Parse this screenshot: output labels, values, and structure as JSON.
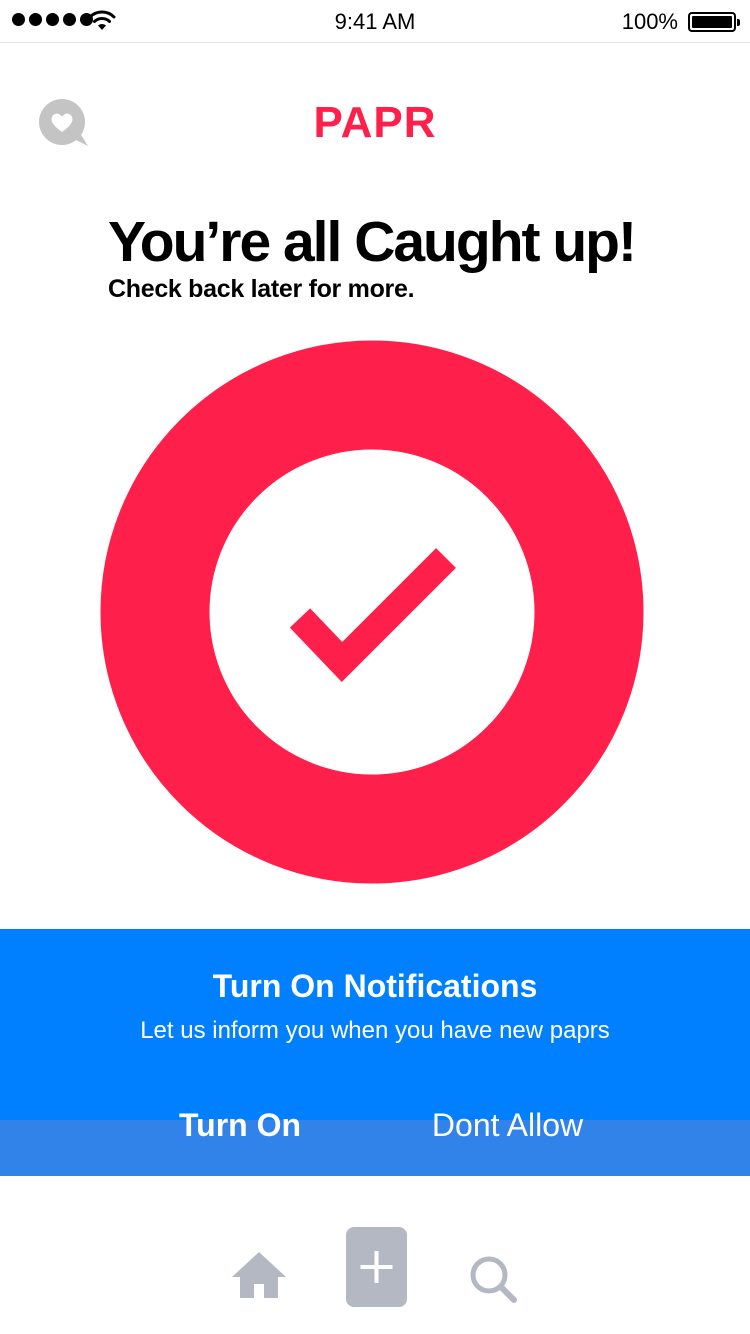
{
  "status_bar": {
    "time": "9:41 AM",
    "battery": "100%"
  },
  "header": {
    "brand": "PAPR",
    "chat_icon": "heart-chat-icon"
  },
  "main": {
    "headline": "You’re all Caught up!",
    "subline": "Check back later for more.",
    "illustration": "check-ring-icon",
    "accent_color": "#ff1f4b"
  },
  "notification_prompt": {
    "title": "Turn On Notifications",
    "message": "Let us inform you when you have new paprs",
    "turn_on_label": "Turn On",
    "dont_allow_label": "Dont Allow",
    "background": "#0080ff"
  },
  "tab_bar": {
    "items": [
      "home-icon",
      "add-icon",
      "search-icon"
    ],
    "icon_color": "#b3b8c3"
  }
}
